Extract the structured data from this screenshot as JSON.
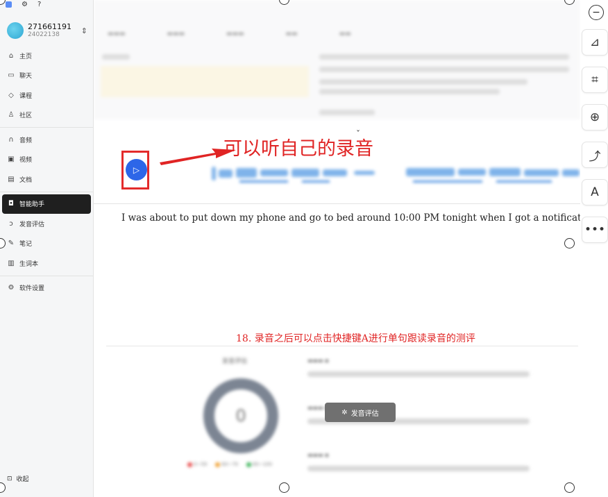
{
  "user": {
    "name": "271661191",
    "id": "24022138"
  },
  "nav": [
    {
      "label": "主页",
      "icon": "home-icon",
      "glyph": "⌂"
    },
    {
      "label": "聊天",
      "icon": "chat-icon",
      "glyph": "▭"
    },
    {
      "label": "课程",
      "icon": "course-icon",
      "glyph": "◇"
    },
    {
      "label": "社区",
      "icon": "community-icon",
      "glyph": "♙"
    },
    {
      "label": "音频",
      "icon": "headphones-icon",
      "glyph": "∩"
    },
    {
      "label": "视频",
      "icon": "video-icon",
      "glyph": "▣"
    },
    {
      "label": "文档",
      "icon": "document-icon",
      "glyph": "▤"
    },
    {
      "label": "智能助手",
      "icon": "robot-icon",
      "glyph": "◘"
    },
    {
      "label": "发音评估",
      "icon": "pronunciation-icon",
      "glyph": "ↄ"
    },
    {
      "label": "笔记",
      "icon": "note-icon",
      "glyph": "✎"
    },
    {
      "label": "生词本",
      "icon": "wordbook-icon",
      "glyph": "▥"
    },
    {
      "label": "软件设置",
      "icon": "settings-icon",
      "glyph": "⚙"
    }
  ],
  "collapse_label": "收起",
  "annotation": "可以听自己的录音",
  "sentence": "I was about to put down my phone and go to bed around 10:00 PM tonight when I got a notificatio",
  "step_note": "18.  录音之后可以点击快捷键A进行单句跟读录音的测评",
  "score": {
    "title": "发音评估",
    "value": "0"
  },
  "legend": [
    "0~59",
    "60~79",
    "80~100"
  ],
  "legend_colors": [
    "#e84b4b",
    "#f0a030",
    "#3cb45a"
  ],
  "toast": "发音评估",
  "accent": "#2d66e8",
  "annotation_color": "#e02424"
}
